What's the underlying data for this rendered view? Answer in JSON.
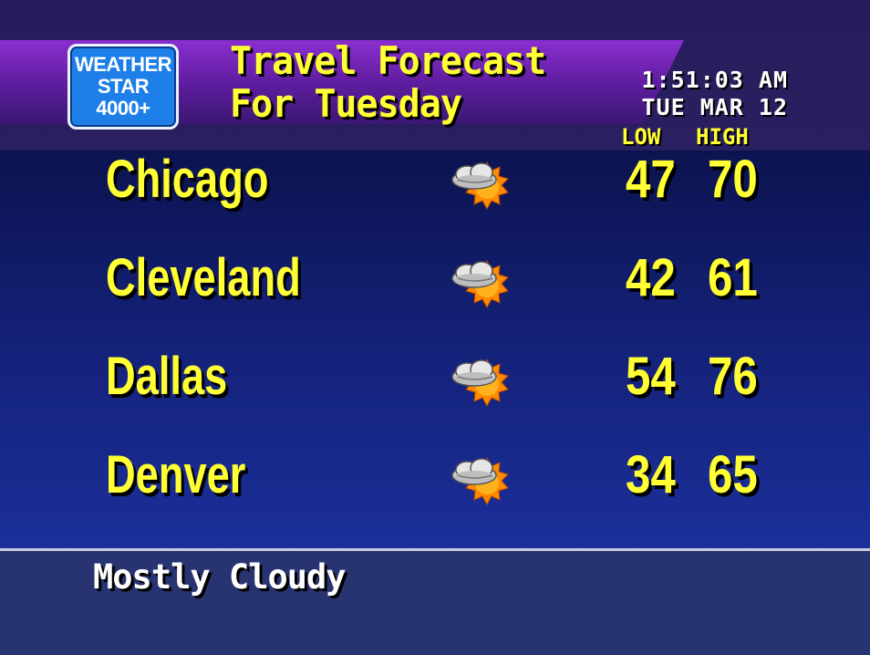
{
  "logo": {
    "line1": "WEATHER",
    "line2": "STAR",
    "line3": "4000+"
  },
  "header": {
    "title_line1": "Travel Forecast",
    "title_line2": "For Tuesday",
    "time": "1:51:03 AM",
    "date": "TUE MAR 12",
    "low_label": "LOW",
    "high_label": "HIGH"
  },
  "cities": [
    {
      "name": "Chicago",
      "icon": "partly-cloudy-icon",
      "low": "47",
      "high": "70"
    },
    {
      "name": "Cleveland",
      "icon": "partly-cloudy-icon",
      "low": "42",
      "high": "61"
    },
    {
      "name": "Dallas",
      "icon": "partly-cloudy-icon",
      "low": "54",
      "high": "76"
    },
    {
      "name": "Denver",
      "icon": "partly-cloudy-icon",
      "low": "34",
      "high": "65"
    }
  ],
  "footer": {
    "condition": "Mostly Cloudy"
  },
  "colors": {
    "text_yellow": "#ffff33",
    "title_band": "#8a2fd0",
    "logo_blue": "#1f7fe8",
    "main_bg": "#15237d",
    "footer_bg": "#283472"
  }
}
